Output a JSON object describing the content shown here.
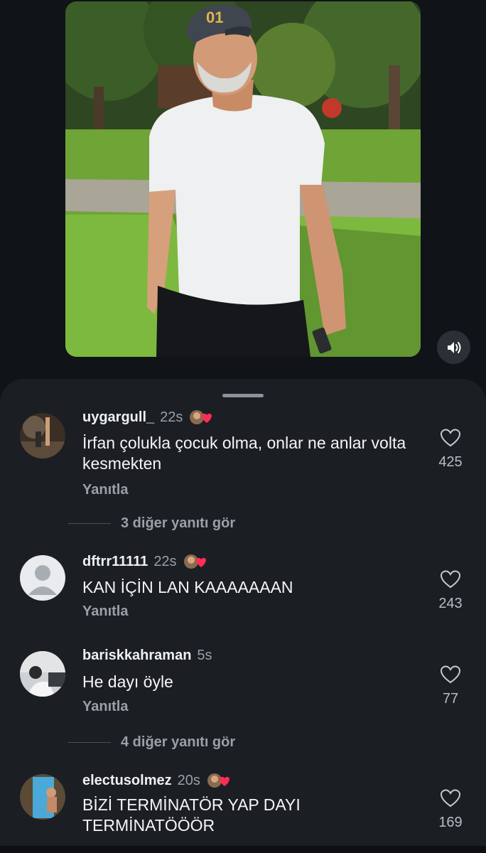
{
  "media": {
    "sound_icon": "speaker-volume-icon"
  },
  "comments": [
    {
      "username": "uygargull_",
      "time": "22s",
      "badge": "creator-heart-badge",
      "text": "İrfan çolukla çocuk olma, onlar ne anlar volta kesmekten",
      "reply_label": "Yanıtla",
      "likes": "425"
    },
    {
      "username": "dftrr11111",
      "time": "22s",
      "badge": "creator-heart-badge",
      "text": "KAN İÇİN LAN KAAAAAAAN",
      "reply_label": "Yanıtla",
      "likes": "243"
    },
    {
      "username": "bariskkahraman",
      "time": "5s",
      "text": "He dayı öyle",
      "reply_label": "Yanıtla",
      "likes": "77"
    },
    {
      "username": "electusolmez",
      "time": "20s",
      "badge": "creator-heart-badge",
      "text": "BİZİ TERMİNATÖR YAP DAYI TERMİNATÖÖÖR",
      "likes": "169"
    }
  ],
  "view_more": [
    {
      "label": "3 diğer yanıtı gör"
    },
    {
      "label": "4 diğer yanıtı gör"
    }
  ],
  "colors": {
    "sheet_bg": "#1b1e23",
    "page_bg": "#101318",
    "heart": "#ff2d55"
  }
}
